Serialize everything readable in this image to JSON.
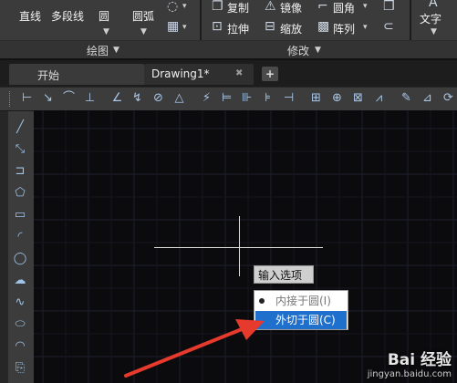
{
  "ribbon": {
    "draw": {
      "line": "直线",
      "polyline": "多段线",
      "circle": "圆",
      "arc": "圆弧"
    },
    "modify": {
      "copy": "复制",
      "mirror": "镜像",
      "fillet": "圆角",
      "stretch": "拉伸",
      "scale": "缩放",
      "array": "阵列"
    },
    "text": "文字",
    "panels": {
      "draw": "绘图",
      "modify": "修改"
    }
  },
  "tabs": [
    {
      "label": "开始"
    },
    {
      "label": "Drawing1*",
      "close": "✖"
    }
  ],
  "new_tab": "+",
  "command_prompt": "输入选项",
  "menu": {
    "items": [
      {
        "label": "内接于圆(I)",
        "selected": false
      },
      {
        "label": "外切于圆(C)",
        "selected": true
      }
    ]
  },
  "watermark": {
    "brand": "Bai 经验",
    "url": "jingyan.baidu.com"
  },
  "colors": {
    "accent": "#1f6fcd",
    "arrow": "#e53a2c",
    "canvas": "#0b0b0e"
  }
}
